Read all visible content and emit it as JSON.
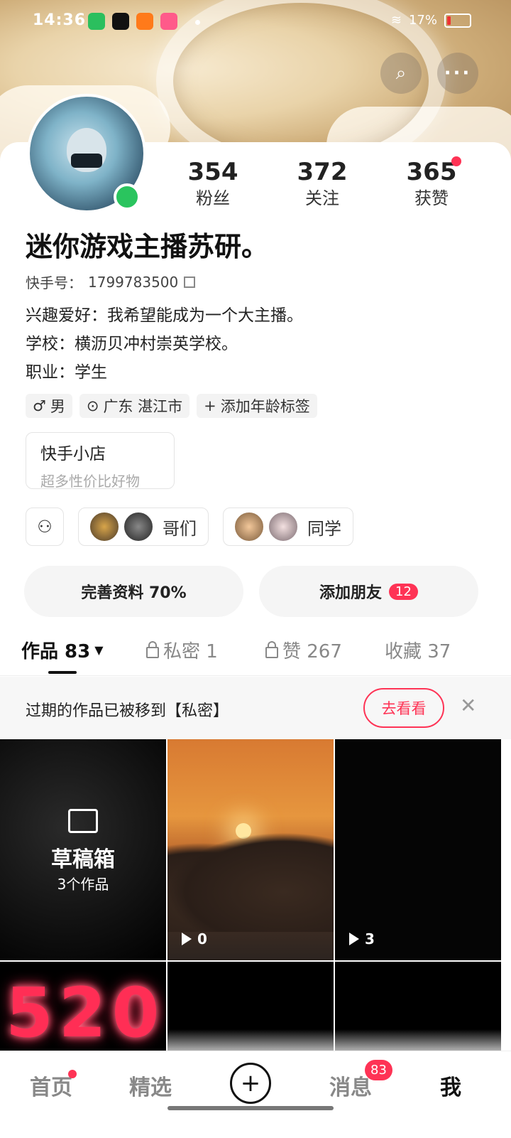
{
  "status_bar": {
    "time": "14:36",
    "battery": "17%"
  },
  "header": {
    "search_label": "⌕",
    "more_label": "···"
  },
  "profile": {
    "stats": [
      {
        "num": "354",
        "label": "粉丝"
      },
      {
        "num": "372",
        "label": "关注"
      },
      {
        "num": "365",
        "label": "获赞"
      }
    ],
    "name": "迷你游戏主播苏研。",
    "kuaishou_id_label": "快手号：",
    "kuaishou_id": "1799783500",
    "bio": [
      "兴趣爱好：我希望能成为一个大主播。",
      "学校：横沥贝冲村崇英学校。",
      "职业：学生"
    ],
    "tags": [
      {
        "icon": "male-icon",
        "text": "男"
      },
      {
        "icon": "location-icon",
        "text": "广东 湛江市"
      },
      {
        "icon": "plus-icon",
        "text": "添加年龄标签"
      }
    ],
    "shop": {
      "title": "快手小店",
      "subtitle": "超多性价比好物"
    },
    "groups": [
      {
        "name": "哥们"
      },
      {
        "name": "同学"
      }
    ],
    "actions": {
      "complete": "完善资料 70%",
      "add_friends": "添加朋友",
      "add_friends_badge": "12"
    }
  },
  "tabs": [
    {
      "label": "作品 83",
      "active": true
    },
    {
      "label": "私密 1"
    },
    {
      "label": "赞 267"
    },
    {
      "label": "收藏 37"
    }
  ],
  "notice": {
    "text": "过期的作品已被移到【私密】",
    "button": "去看看"
  },
  "grid": {
    "draft": {
      "title": "草稿箱",
      "subtitle": "3个作品"
    },
    "tiles": [
      {
        "plays": "0"
      },
      {
        "plays": "3"
      }
    ],
    "tile4_text": "520"
  },
  "bottom_nav": {
    "home": "首页",
    "featured": "精选",
    "messages": "消息",
    "messages_badge": "83",
    "me": "我"
  },
  "colors": {
    "accent": "#fe3355",
    "online": "#2ac45e"
  }
}
